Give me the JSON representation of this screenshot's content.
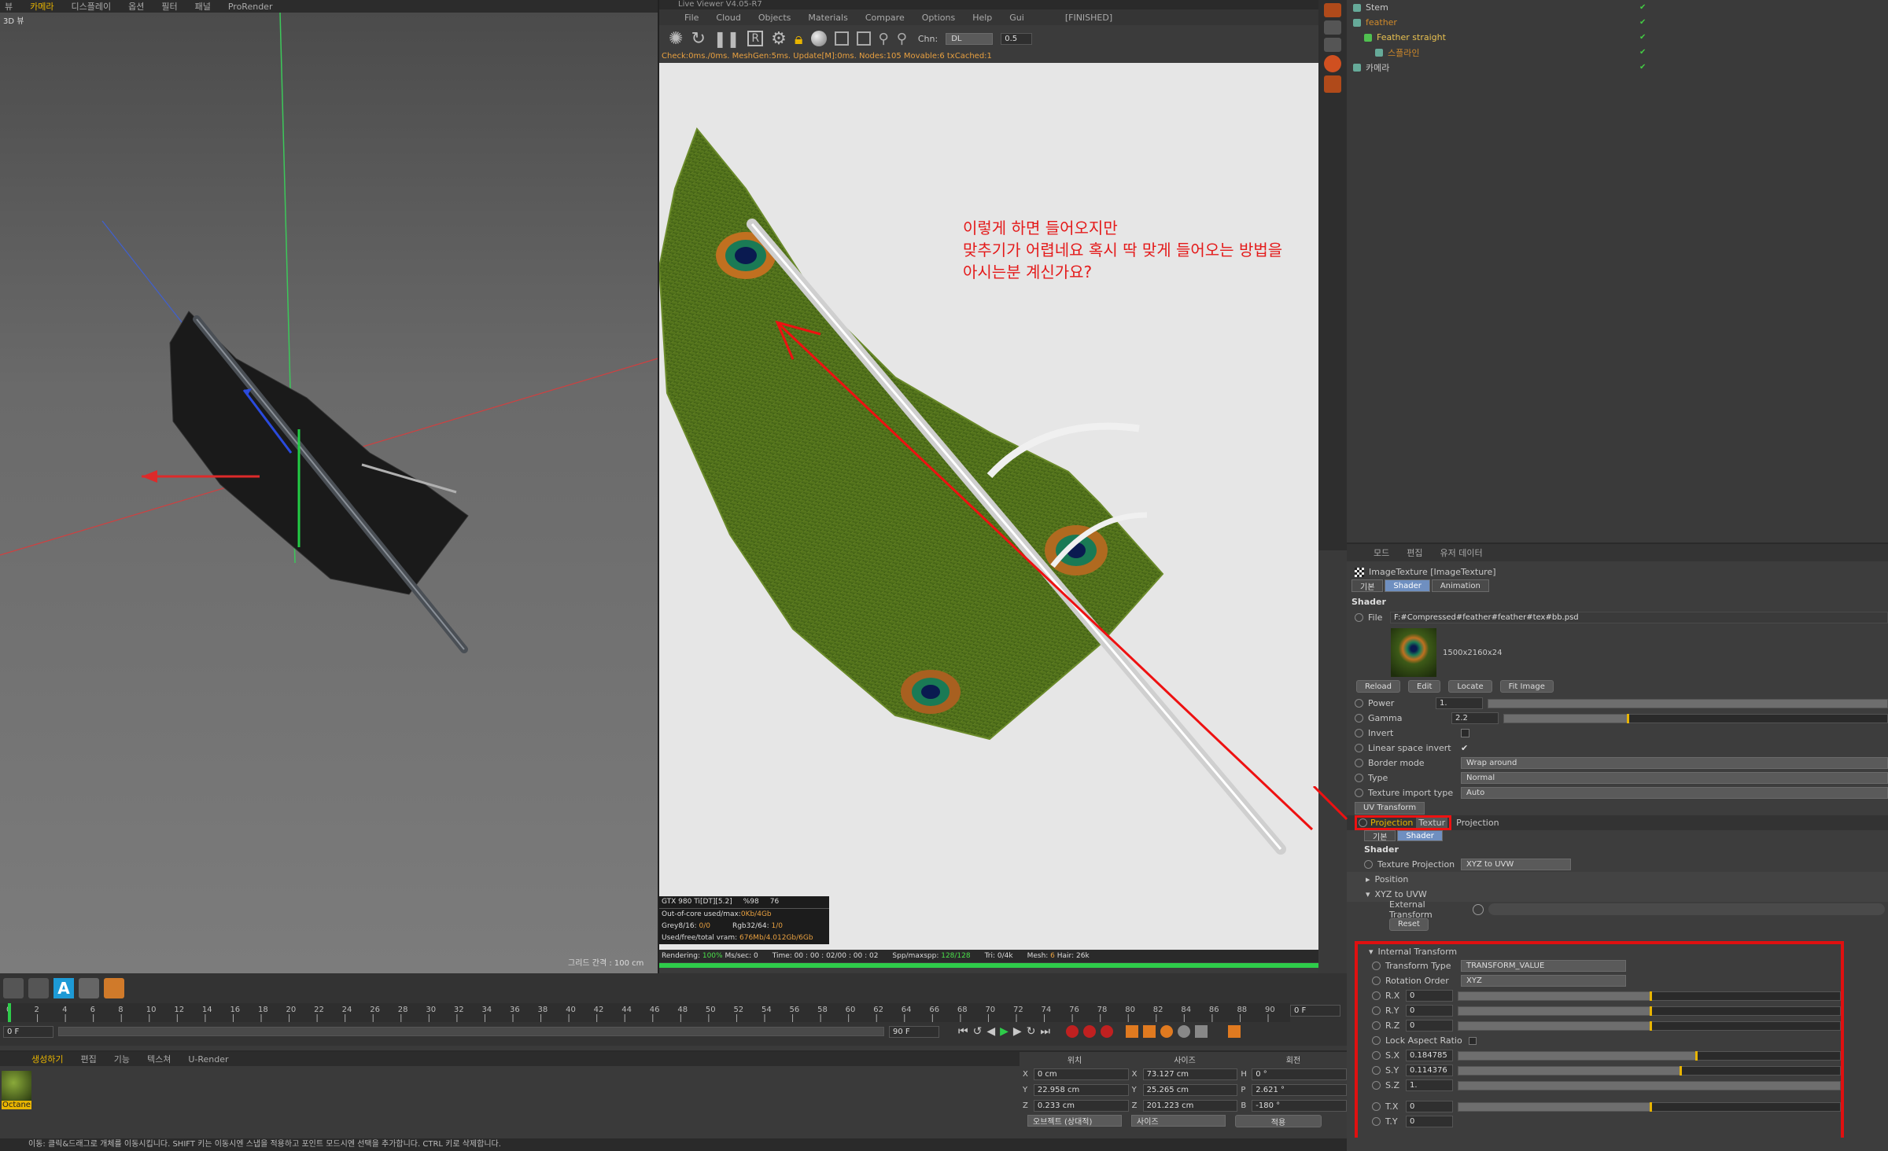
{
  "left_viewport": {
    "menu": [
      "뷰",
      "카메라",
      "디스플레이",
      "옵션",
      "필터",
      "패널",
      "ProRender"
    ],
    "view_label": "3D 뷰",
    "grid_spacing": "그리드 간격 : 100 cm"
  },
  "live_viewer": {
    "title": "Live Viewer V4.05-R7",
    "menu": [
      "File",
      "Cloud",
      "Objects",
      "Materials",
      "Compare",
      "Options",
      "Help",
      "Gui"
    ],
    "status_tag": "[FINISHED]",
    "channel_label": "Chn:",
    "channel_value": "DL",
    "channel_num": "0.5",
    "stats_line": "Check:0ms./0ms. MeshGen:5ms. Update[M]:0ms. Nodes:105 Movable:6 txCached:1",
    "annotation_line1": "이렇게 하면 들어오지만",
    "annotation_line2": "맞추기가 어렵네요 혹시 딱 맞게 들어오는 방법을",
    "annotation_line3": "아시는분 계신가요?",
    "gpu": {
      "name": "GTX 980 Ti[DT][5.2]",
      "pct": "%98",
      "temp": "76",
      "ooc_label": "Out-of-core used/max:",
      "ooc_value": "0Kb/4Gb",
      "grey_label": "Grey8/16:",
      "grey_value": "0/0",
      "rgb_label": "Rgb32/64:",
      "rgb_value": "1/0",
      "vram_label": "Used/free/total vram:",
      "vram_value": "676Mb/4.012Gb/6Gb"
    },
    "render_status": {
      "rendering": "Rendering: ",
      "rendering_val": "100%",
      "mssec": " Ms/sec: 0",
      "time": "Time: 00 : 00 : 02/00 : 00 : 02",
      "spp": "Spp/maxspp: ",
      "spp_val": "128/128",
      "tri": "Tri: 0/4k",
      "mesh": "Mesh: ",
      "mesh_val": "6",
      "hair": " Hair: 26k"
    },
    "progress": 1.0
  },
  "object_manager": {
    "items": [
      {
        "name": "Stem",
        "indent": 0,
        "color": "#c8c8c8"
      },
      {
        "name": "feather",
        "indent": 0,
        "color": "#d08a2a"
      },
      {
        "name": "Feather straight",
        "indent": 1,
        "color": "#e8c050"
      },
      {
        "name": "스플라인",
        "indent": 2,
        "color": "#d08a2a"
      },
      {
        "name": "카메라",
        "indent": 0,
        "color": "#c8c8c8"
      }
    ]
  },
  "attr": {
    "menu": [
      "모드",
      "편집",
      "유저 데이터"
    ],
    "title": "ImageTexture [ImageTexture]",
    "tabs": [
      "기본",
      "Shader",
      "Animation"
    ],
    "section_shader": "Shader",
    "file_label": "File",
    "file_path": "F:#Compressed#feather#feather#tex#bb.psd",
    "image_size": "1500x2160x24",
    "buttons": [
      "Reload",
      "Edit",
      "Locate",
      "Fit Image"
    ],
    "power_label": "Power",
    "power_value": "1.",
    "gamma_label": "Gamma",
    "gamma_value": "2.2",
    "gamma_level": 0.32,
    "invert_label": "Invert",
    "linear_label": "Linear space invert",
    "linear_check": "✔",
    "border_label": "Border mode",
    "border_value": "Wrap around",
    "type_label": "Type",
    "type_value": "Normal",
    "import_label": "Texture import type",
    "import_value": "Auto",
    "uv_transform": "UV Transform",
    "projection_tab": "Projection",
    "texture_tab": "Textur",
    "projection_label": "Projection",
    "sub_tabs": [
      "기본",
      "Shader"
    ],
    "sub_section": "Shader",
    "tex_proj_label": "Texture Projection",
    "tex_proj_value": "XYZ to UVW",
    "position_group": "Position",
    "xyz_group": "XYZ to UVW",
    "ext_transform": "External Transform",
    "reset": "Reset",
    "internal_transform": "Internal Transform",
    "transform_type_label": "Transform Type",
    "transform_type_value": "TRANSFORM_VALUE",
    "rotation_order_label": "Rotation Order",
    "rotation_order_value": "XYZ",
    "rx": "0",
    "ry": "0",
    "rz": "0",
    "lock_label": "Lock Aspect Ratio",
    "sx": "0.184785",
    "sy": "0.114376",
    "sz": "1.",
    "tx": "0",
    "ty": "0",
    "sx_level": 0.62,
    "sy_level": 0.58,
    "sz_level": 1.0
  },
  "timeline": {
    "ticks": [
      "0",
      "2",
      "4",
      "6",
      "8",
      "10",
      "12",
      "14",
      "16",
      "18",
      "20",
      "22",
      "24",
      "26",
      "28",
      "30",
      "32",
      "34",
      "36",
      "38",
      "40",
      "42",
      "44",
      "46",
      "48",
      "50",
      "52",
      "54",
      "56",
      "58",
      "60",
      "62",
      "64",
      "66",
      "68",
      "70",
      "72",
      "74",
      "76",
      "78",
      "80",
      "82",
      "84",
      "86",
      "88",
      "90"
    ],
    "current_frame": "0 F",
    "start": "0 F",
    "end_field": "90 F",
    "end_field2": "90 F"
  },
  "material_manager": {
    "menu": [
      "생성하기",
      "편집",
      "기능",
      "텍스쳐",
      "U-Render"
    ],
    "mat_name": "Octane"
  },
  "coords": {
    "headers": [
      "위치",
      "사이즈",
      "회전"
    ],
    "rows": [
      {
        "a": "X",
        "av": "0 cm",
        "b": "X",
        "bv": "73.127 cm",
        "c": "H",
        "cv": "0 °"
      },
      {
        "a": "Y",
        "av": "22.958 cm",
        "b": "Y",
        "bv": "25.265 cm",
        "c": "P",
        "cv": "2.621 °"
      },
      {
        "a": "Z",
        "av": "0.233 cm",
        "b": "Z",
        "bv": "201.223 cm",
        "c": "B",
        "cv": "-180 °"
      }
    ],
    "mode1": "오브젝트 (상대적)",
    "mode2": "사이즈",
    "apply": "적용"
  },
  "status_bar": "이동: 클릭&드래그로 개체를 이동시킵니다. SHIFT 키는 이동시엔 스냅을 적용하고 포인트 모드시엔 선택을 추가합니다. CTRL 키로 삭제합니다."
}
